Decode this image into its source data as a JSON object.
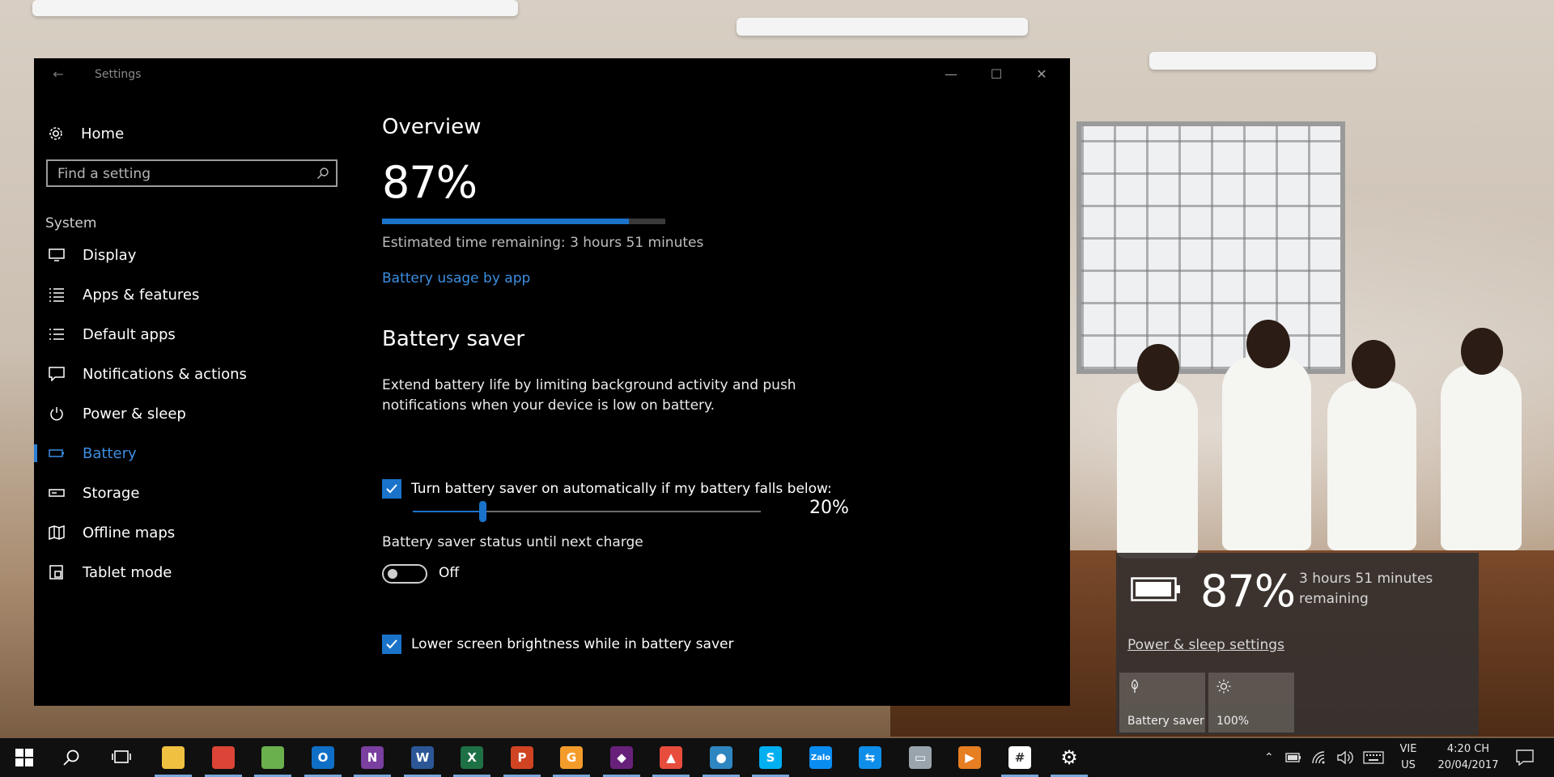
{
  "window": {
    "title": "Settings",
    "controls": {
      "minimize": "—",
      "maximize": "☐",
      "close": "✕"
    }
  },
  "sidebar": {
    "home_label": "Home",
    "search_placeholder": "Find a setting",
    "section_label": "System",
    "items": [
      {
        "label": "Display",
        "icon": "display-icon"
      },
      {
        "label": "Apps & features",
        "icon": "apps-list-icon"
      },
      {
        "label": "Default apps",
        "icon": "default-apps-icon"
      },
      {
        "label": "Notifications & actions",
        "icon": "notification-icon"
      },
      {
        "label": "Power & sleep",
        "icon": "power-icon"
      },
      {
        "label": "Battery",
        "icon": "battery-icon",
        "active": true
      },
      {
        "label": "Storage",
        "icon": "storage-icon"
      },
      {
        "label": "Offline maps",
        "icon": "map-icon"
      },
      {
        "label": "Tablet mode",
        "icon": "tablet-icon"
      }
    ]
  },
  "overview": {
    "heading": "Overview",
    "percent_text": "87%",
    "percent_value": 0.87,
    "estimate": "Estimated time remaining: 3 hours 51 minutes",
    "usage_link": "Battery usage by app"
  },
  "battery_saver": {
    "heading": "Battery saver",
    "description": "Extend battery life by limiting background activity and push notifications when your device is low on battery.",
    "auto_checkbox_label": "Turn battery saver on automatically if my battery falls below:",
    "auto_checked": true,
    "threshold_text": "20%",
    "threshold_value": 0.2,
    "status_label": "Battery saver status until next charge",
    "status_toggle_text": "Off",
    "brightness_checkbox_label": "Lower screen brightness while in battery saver",
    "brightness_checked": true
  },
  "flyout": {
    "percent_text": "87%",
    "remaining_line1": "3 hours 51 minutes",
    "remaining_line2": "remaining",
    "settings_link": "Power & sleep settings",
    "tiles": [
      {
        "label": "Battery saver",
        "icon": "battery-saver-leaf-icon"
      },
      {
        "label": "100%",
        "icon": "brightness-sun-icon"
      }
    ]
  },
  "taskbar": {
    "apps": [
      {
        "name": "file-explorer",
        "color": "#f0c040",
        "glyph": ""
      },
      {
        "name": "chrome",
        "color": "#db4437",
        "glyph": ""
      },
      {
        "name": "coccoc",
        "color": "#6ab04c",
        "glyph": ""
      },
      {
        "name": "outlook",
        "color": "#0f6fc6",
        "glyph": "O"
      },
      {
        "name": "onenote",
        "color": "#7b3fa0",
        "glyph": "N"
      },
      {
        "name": "word",
        "color": "#2b5797",
        "glyph": "W"
      },
      {
        "name": "excel",
        "color": "#1e7145",
        "glyph": "X"
      },
      {
        "name": "powerpoint",
        "color": "#d04423",
        "glyph": "P"
      },
      {
        "name": "foxit-pdf",
        "color": "#f39c2b",
        "glyph": "G"
      },
      {
        "name": "visual-studio",
        "color": "#68217a",
        "glyph": "◆"
      },
      {
        "name": "photo-app",
        "color": "#e74c3c",
        "glyph": "▲"
      },
      {
        "name": "map-app",
        "color": "#2e86c1",
        "glyph": "●"
      },
      {
        "name": "skype",
        "color": "#00aff0",
        "glyph": "S"
      },
      {
        "name": "zalo",
        "color": "#0a8df0",
        "glyph": "Zalo"
      },
      {
        "name": "teamviewer",
        "color": "#0e8ee9",
        "glyph": "⇆"
      },
      {
        "name": "remote-desktop",
        "color": "#9aa4ad",
        "glyph": "▭"
      },
      {
        "name": "media-player",
        "color": "#e67e22",
        "glyph": "▶"
      },
      {
        "name": "slack",
        "color": "#ffffff",
        "glyph": "#"
      },
      {
        "name": "settings",
        "color": "#101010",
        "glyph": "⚙"
      }
    ],
    "language_top": "VIE",
    "language_bottom": "US",
    "time": "4:20 CH",
    "date": "20/04/2017"
  }
}
